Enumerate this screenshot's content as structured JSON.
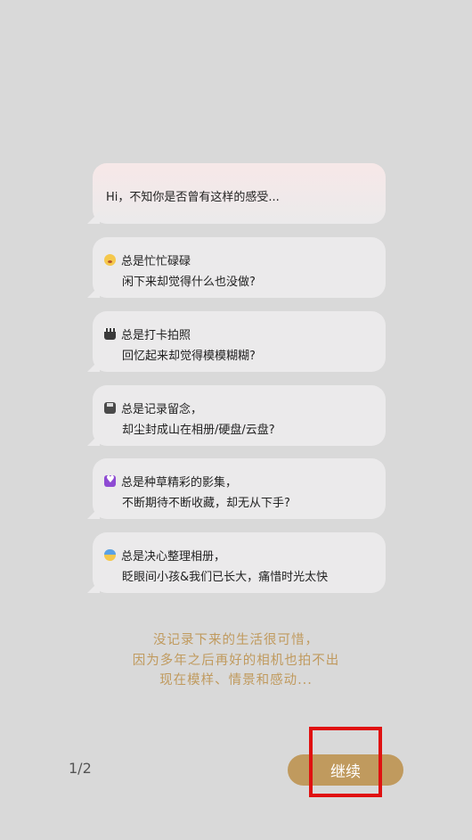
{
  "intro": "Hi，不知你是否曾有这样的感受...",
  "items": [
    {
      "icon": "dizzy-face-icon",
      "title": "总是忙忙碌碌",
      "subtitle": "闲下来却觉得什么也没做?"
    },
    {
      "icon": "clapper-board-icon",
      "title": "总是打卡拍照",
      "subtitle": "回忆起来却觉得模模糊糊?"
    },
    {
      "icon": "floppy-disk-icon",
      "title": "总是记录留念，",
      "subtitle": "却尘封成山在相册/硬盘/云盘?"
    },
    {
      "icon": "heart-icon",
      "title": "总是种草精彩的影集，",
      "subtitle": "不断期待不断收藏，却无从下手?"
    },
    {
      "icon": "fearful-face-icon",
      "title": "总是决心整理相册，",
      "subtitle": "眨眼间小孩&我们已长大，痛惜时光太快"
    }
  ],
  "quote": [
    "没记录下来的生活很可惜，",
    "因为多年之后再好的相机也拍不出",
    "现在模样、情景和感动..."
  ],
  "pager": "1/2",
  "continue_label": "继续",
  "colors": {
    "accent": "#c09a5e",
    "background": "#d9d9d9",
    "bubble": "#ebeaeb",
    "highlight": "#e01010"
  }
}
